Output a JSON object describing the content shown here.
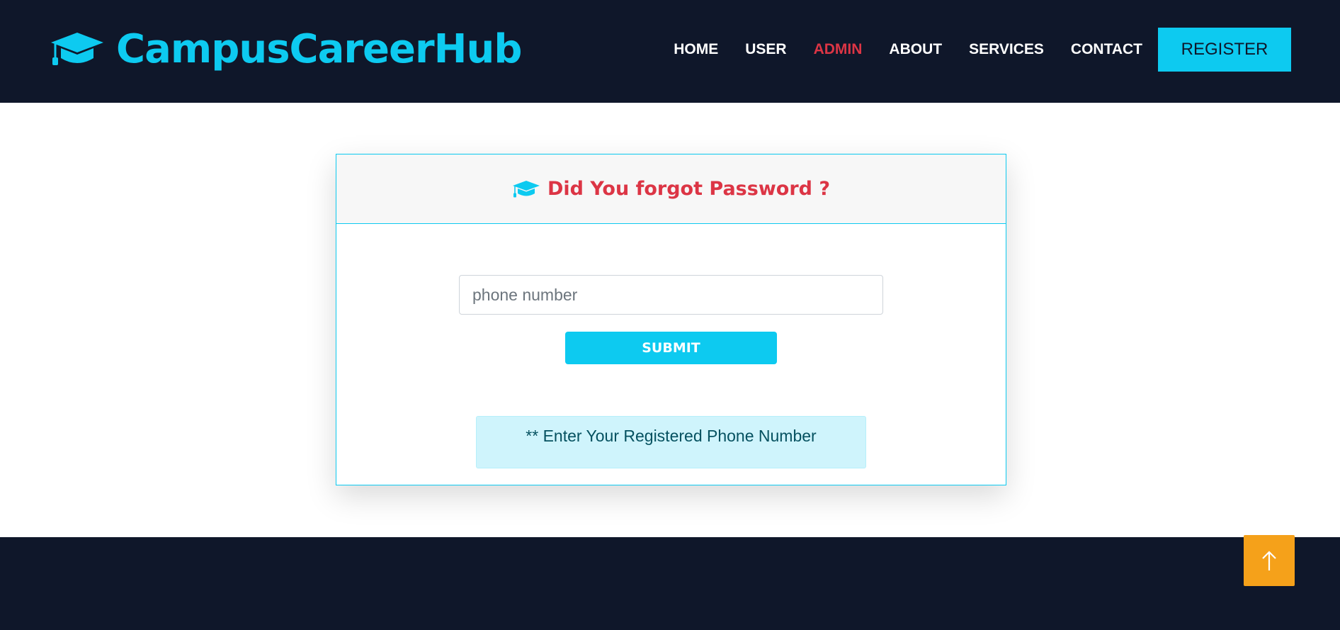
{
  "brand": {
    "name": "CampusCareerHub",
    "icon": "graduation-cap-icon",
    "color": "#0dcaf0"
  },
  "nav": {
    "items": [
      {
        "label": "HOME",
        "active": false
      },
      {
        "label": "USER",
        "active": false
      },
      {
        "label": "ADMIN",
        "active": true
      },
      {
        "label": "ABOUT",
        "active": false
      },
      {
        "label": "SERVICES",
        "active": false
      },
      {
        "label": "CONTACT",
        "active": false
      }
    ],
    "register_label": "REGISTER"
  },
  "card": {
    "title": "Did You forgot Password ?",
    "title_icon": "graduation-cap-icon",
    "phone_placeholder": "phone number",
    "submit_label": "SUBMIT",
    "info_text": "** Enter Your Registered Phone Number"
  },
  "back_to_top": {
    "icon": "arrow-up-icon"
  },
  "colors": {
    "navbar_bg": "#0f172a",
    "accent": "#0dcaf0",
    "active_link": "#dc3545",
    "title": "#dc3545",
    "back_to_top_bg": "#f5a11a",
    "info_bg": "#cff4fc"
  }
}
